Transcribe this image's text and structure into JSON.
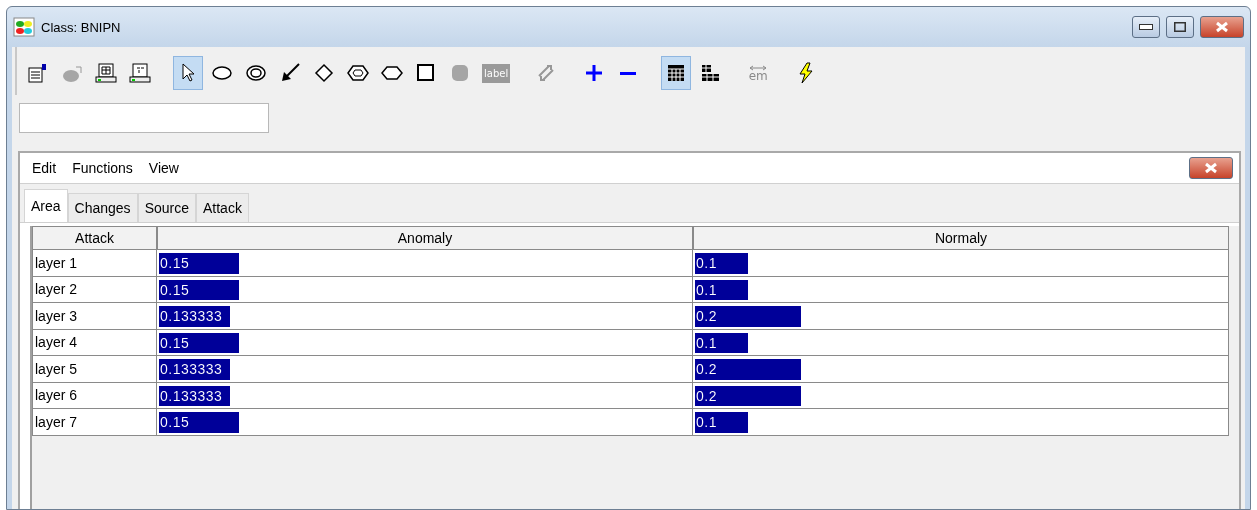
{
  "window": {
    "title": "Class: BNIPN"
  },
  "toolbar": [
    {
      "items": [
        {
          "kind": "properties",
          "selected": false,
          "disabled": false
        },
        {
          "kind": "cloud",
          "selected": false,
          "disabled": true
        },
        {
          "kind": "monitor-grid",
          "selected": false,
          "disabled": false
        },
        {
          "kind": "monitor-tree",
          "selected": false,
          "disabled": false
        }
      ]
    },
    {
      "items": [
        {
          "kind": "pointer",
          "selected": true,
          "disabled": false
        },
        {
          "kind": "ellipse",
          "selected": false,
          "disabled": false
        },
        {
          "kind": "double-ellipse",
          "selected": false,
          "disabled": false
        },
        {
          "kind": "arrow",
          "selected": false,
          "disabled": false
        },
        {
          "kind": "diamond",
          "selected": false,
          "disabled": false
        },
        {
          "kind": "double-hexagon",
          "selected": false,
          "disabled": false
        },
        {
          "kind": "hexagon",
          "selected": false,
          "disabled": false
        },
        {
          "kind": "square",
          "selected": false,
          "disabled": false
        },
        {
          "kind": "rounded-square",
          "selected": false,
          "disabled": true
        },
        {
          "kind": "label",
          "text": "label",
          "selected": false,
          "disabled": true
        }
      ]
    },
    {
      "items": [
        {
          "kind": "transform",
          "selected": false,
          "disabled": true
        }
      ]
    },
    {
      "items": [
        {
          "kind": "plus",
          "selected": false,
          "disabled": false
        },
        {
          "kind": "minus",
          "selected": false,
          "disabled": false
        }
      ]
    },
    {
      "items": [
        {
          "kind": "grid-view",
          "selected": true,
          "disabled": false
        },
        {
          "kind": "tree-view",
          "selected": false,
          "disabled": false
        }
      ]
    },
    {
      "items": [
        {
          "kind": "em",
          "text": "em",
          "selected": false,
          "disabled": true
        }
      ]
    },
    {
      "items": [
        {
          "kind": "lightning",
          "selected": false,
          "disabled": false
        }
      ]
    }
  ],
  "panel": {
    "menu": [
      "Edit",
      "Functions",
      "View"
    ],
    "tabs": [
      {
        "label": "Area",
        "selected": true
      },
      {
        "label": "Changes",
        "selected": false
      },
      {
        "label": "Source",
        "selected": false
      },
      {
        "label": "Attack",
        "selected": false
      }
    ],
    "table": {
      "columns": [
        "Attack",
        "Anomaly",
        "Normaly"
      ],
      "rows": [
        {
          "name": "layer 1",
          "anomaly": {
            "text": "0.15",
            "level": 0.15
          },
          "normaly": {
            "text": "0.1",
            "level": 0.1
          }
        },
        {
          "name": "layer 2",
          "anomaly": {
            "text": "0.15",
            "level": 0.15
          },
          "normaly": {
            "text": "0.1",
            "level": 0.1
          }
        },
        {
          "name": "layer 3",
          "anomaly": {
            "text": "0.133333",
            "level": 0.133333
          },
          "normaly": {
            "text": "0.2",
            "level": 0.2
          }
        },
        {
          "name": "layer 4",
          "anomaly": {
            "text": "0.15",
            "level": 0.15
          },
          "normaly": {
            "text": "0.1",
            "level": 0.1
          }
        },
        {
          "name": "layer 5",
          "anomaly": {
            "text": "0.133333",
            "level": 0.133333
          },
          "normaly": {
            "text": "0.2",
            "level": 0.2
          }
        },
        {
          "name": "layer 6",
          "anomaly": {
            "text": "0.133333",
            "level": 0.133333
          },
          "normaly": {
            "text": "0.2",
            "level": 0.2
          }
        },
        {
          "name": "layer 7",
          "anomaly": {
            "text": "0.15",
            "level": 0.15
          },
          "normaly": {
            "text": "0.1",
            "level": 0.1
          }
        }
      ]
    }
  }
}
